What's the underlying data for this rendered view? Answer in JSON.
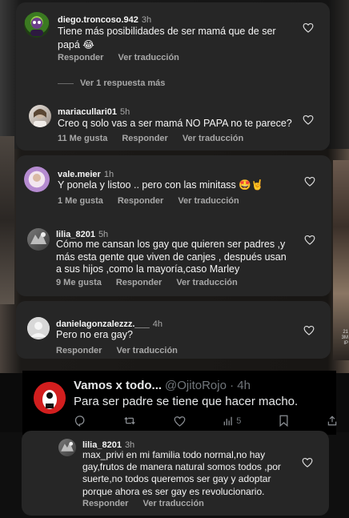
{
  "comments": [
    {
      "username": "diego.troncoso.942",
      "time": "3h",
      "text_lines": [
        "Tiene más posibilidades de ser mamá que de ser",
        "papá 😂"
      ],
      "actions": [
        "Responder",
        "Ver traducción"
      ],
      "view_replies": "Ver 1 respuesta más"
    },
    {
      "username": "mariacullari01",
      "time": "5h",
      "text_lines": [
        "Creo q solo vas a ser mamá NO PAPA no te parece?"
      ],
      "actions": [
        "11 Me gusta",
        "Responder",
        "Ver traducción"
      ]
    },
    {
      "username": "vale.meier",
      "time": "1h",
      "text_lines": [
        "Y ponela y listoo .. pero con las minitass 🤩🤘"
      ],
      "actions": [
        "1 Me gusta",
        "Responder",
        "Ver traducción"
      ]
    },
    {
      "username": "lilia_8201",
      "time": "5h",
      "text_lines": [
        "Cómo me cansan los gay que quieren ser padres ,y",
        "más esta gente que viven de canjes , después usan",
        "a sus hijos ,como la mayoría,caso Marley"
      ],
      "actions": [
        "9 Me gusta",
        "Responder",
        "Ver traducción"
      ]
    },
    {
      "username": "danielagonzalezzz.___",
      "time": "4h",
      "text_lines": [
        "Pero no era gay?"
      ],
      "actions": [
        "Responder",
        "Ver traducción"
      ]
    }
  ],
  "tweet": {
    "name": "Vamos x todo...",
    "handle": "@OjitoRojo · 4h",
    "text": "Para ser padre se tiene que hacer macho.",
    "views": "5"
  },
  "reply": {
    "username": "lilia_8201",
    "time": "3h",
    "text_lines": [
      "max_privi en mi familia todo normal,no hay",
      "gay,frutos de manera natural somos todos ,por",
      "suerte,no todos queremos ser gay y adoptar",
      "porque ahora es ser gay es revolucionario."
    ],
    "actions": [
      "Responder",
      "Ver traducción"
    ]
  },
  "side_text": [
    "21",
    "3M",
    "IP"
  ]
}
